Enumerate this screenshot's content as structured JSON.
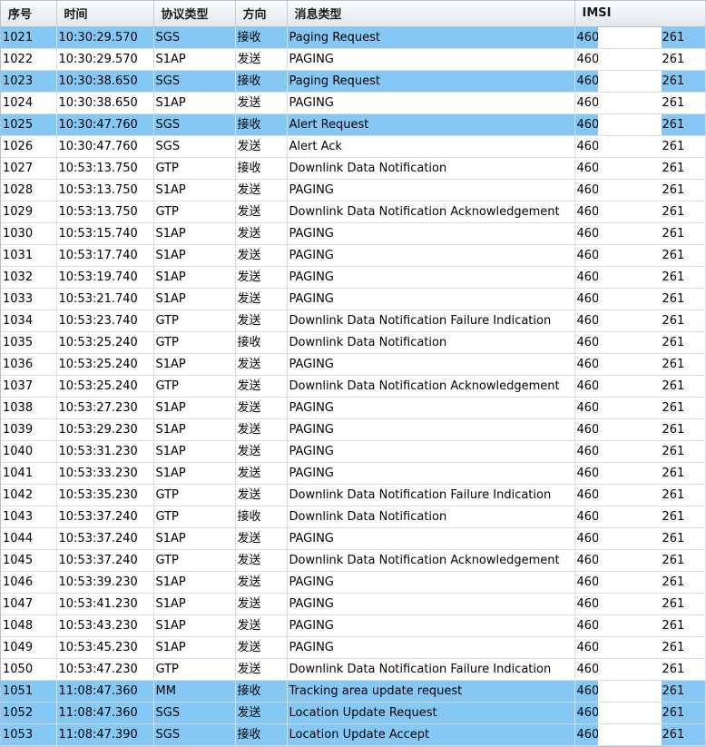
{
  "columns": [
    "序号",
    "时间",
    "协议类型",
    "方向",
    "消息类型",
    "IMSI"
  ],
  "colors": {
    "selected_row": "#86c8f5",
    "header_bg": "#e3e8ee",
    "grid_line": "#d8dde3"
  },
  "rows": [
    {
      "id": "1021",
      "time": "10:30:29.570",
      "proto": "SGS",
      "dir": "接收",
      "msg": "Paging Request",
      "imsi_prefix": "460",
      "imsi_suffix": "261",
      "selected": true
    },
    {
      "id": "1022",
      "time": "10:30:29.570",
      "proto": "S1AP",
      "dir": "发送",
      "msg": "PAGING",
      "imsi_prefix": "460",
      "imsi_suffix": "261",
      "selected": false
    },
    {
      "id": "1023",
      "time": "10:30:38.650",
      "proto": "SGS",
      "dir": "接收",
      "msg": "Paging Request",
      "imsi_prefix": "460",
      "imsi_suffix": "261",
      "selected": true
    },
    {
      "id": "1024",
      "time": "10:30:38.650",
      "proto": "S1AP",
      "dir": "发送",
      "msg": "PAGING",
      "imsi_prefix": "460",
      "imsi_suffix": "261",
      "selected": false
    },
    {
      "id": "1025",
      "time": "10:30:47.760",
      "proto": "SGS",
      "dir": "接收",
      "msg": "Alert Request",
      "imsi_prefix": "460",
      "imsi_suffix": "261",
      "selected": true
    },
    {
      "id": "1026",
      "time": "10:30:47.760",
      "proto": "SGS",
      "dir": "发送",
      "msg": "Alert Ack",
      "imsi_prefix": "460",
      "imsi_suffix": "261",
      "selected": false
    },
    {
      "id": "1027",
      "time": "10:53:13.750",
      "proto": "GTP",
      "dir": "接收",
      "msg": "Downlink Data Notification",
      "imsi_prefix": "460",
      "imsi_suffix": "261",
      "selected": false
    },
    {
      "id": "1028",
      "time": "10:53:13.750",
      "proto": "S1AP",
      "dir": "发送",
      "msg": "PAGING",
      "imsi_prefix": "460",
      "imsi_suffix": "261",
      "selected": false
    },
    {
      "id": "1029",
      "time": "10:53:13.750",
      "proto": "GTP",
      "dir": "发送",
      "msg": "Downlink Data Notification Acknowledgement",
      "imsi_prefix": "460",
      "imsi_suffix": "261",
      "selected": false
    },
    {
      "id": "1030",
      "time": "10:53:15.740",
      "proto": "S1AP",
      "dir": "发送",
      "msg": "PAGING",
      "imsi_prefix": "460",
      "imsi_suffix": "261",
      "selected": false
    },
    {
      "id": "1031",
      "time": "10:53:17.740",
      "proto": "S1AP",
      "dir": "发送",
      "msg": "PAGING",
      "imsi_prefix": "460",
      "imsi_suffix": "261",
      "selected": false
    },
    {
      "id": "1032",
      "time": "10:53:19.740",
      "proto": "S1AP",
      "dir": "发送",
      "msg": "PAGING",
      "imsi_prefix": "460",
      "imsi_suffix": "261",
      "selected": false
    },
    {
      "id": "1033",
      "time": "10:53:21.740",
      "proto": "S1AP",
      "dir": "发送",
      "msg": "PAGING",
      "imsi_prefix": "460",
      "imsi_suffix": "261",
      "selected": false
    },
    {
      "id": "1034",
      "time": "10:53:23.740",
      "proto": "GTP",
      "dir": "发送",
      "msg": "Downlink Data Notification Failure Indication",
      "imsi_prefix": "460",
      "imsi_suffix": "261",
      "selected": false
    },
    {
      "id": "1035",
      "time": "10:53:25.240",
      "proto": "GTP",
      "dir": "接收",
      "msg": "Downlink Data Notification",
      "imsi_prefix": "460",
      "imsi_suffix": "261",
      "selected": false
    },
    {
      "id": "1036",
      "time": "10:53:25.240",
      "proto": "S1AP",
      "dir": "发送",
      "msg": "PAGING",
      "imsi_prefix": "460",
      "imsi_suffix": "261",
      "selected": false
    },
    {
      "id": "1037",
      "time": "10:53:25.240",
      "proto": "GTP",
      "dir": "发送",
      "msg": "Downlink Data Notification Acknowledgement",
      "imsi_prefix": "460",
      "imsi_suffix": "261",
      "selected": false
    },
    {
      "id": "1038",
      "time": "10:53:27.230",
      "proto": "S1AP",
      "dir": "发送",
      "msg": "PAGING",
      "imsi_prefix": "460",
      "imsi_suffix": "261",
      "selected": false
    },
    {
      "id": "1039",
      "time": "10:53:29.230",
      "proto": "S1AP",
      "dir": "发送",
      "msg": "PAGING",
      "imsi_prefix": "460",
      "imsi_suffix": "261",
      "selected": false
    },
    {
      "id": "1040",
      "time": "10:53:31.230",
      "proto": "S1AP",
      "dir": "发送",
      "msg": "PAGING",
      "imsi_prefix": "460",
      "imsi_suffix": "261",
      "selected": false
    },
    {
      "id": "1041",
      "time": "10:53:33.230",
      "proto": "S1AP",
      "dir": "发送",
      "msg": "PAGING",
      "imsi_prefix": "460",
      "imsi_suffix": "261",
      "selected": false
    },
    {
      "id": "1042",
      "time": "10:53:35.230",
      "proto": "GTP",
      "dir": "发送",
      "msg": "Downlink Data Notification Failure Indication",
      "imsi_prefix": "460",
      "imsi_suffix": "261",
      "selected": false
    },
    {
      "id": "1043",
      "time": "10:53:37.240",
      "proto": "GTP",
      "dir": "接收",
      "msg": "Downlink Data Notification",
      "imsi_prefix": "460",
      "imsi_suffix": "261",
      "selected": false
    },
    {
      "id": "1044",
      "time": "10:53:37.240",
      "proto": "S1AP",
      "dir": "发送",
      "msg": "PAGING",
      "imsi_prefix": "460",
      "imsi_suffix": "261",
      "selected": false
    },
    {
      "id": "1045",
      "time": "10:53:37.240",
      "proto": "GTP",
      "dir": "发送",
      "msg": "Downlink Data Notification Acknowledgement",
      "imsi_prefix": "460",
      "imsi_suffix": "261",
      "selected": false
    },
    {
      "id": "1046",
      "time": "10:53:39.230",
      "proto": "S1AP",
      "dir": "发送",
      "msg": "PAGING",
      "imsi_prefix": "460",
      "imsi_suffix": "261",
      "selected": false
    },
    {
      "id": "1047",
      "time": "10:53:41.230",
      "proto": "S1AP",
      "dir": "发送",
      "msg": "PAGING",
      "imsi_prefix": "460",
      "imsi_suffix": "261",
      "selected": false
    },
    {
      "id": "1048",
      "time": "10:53:43.230",
      "proto": "S1AP",
      "dir": "发送",
      "msg": "PAGING",
      "imsi_prefix": "460",
      "imsi_suffix": "261",
      "selected": false
    },
    {
      "id": "1049",
      "time": "10:53:45.230",
      "proto": "S1AP",
      "dir": "发送",
      "msg": "PAGING",
      "imsi_prefix": "460",
      "imsi_suffix": "261",
      "selected": false
    },
    {
      "id": "1050",
      "time": "10:53:47.230",
      "proto": "GTP",
      "dir": "发送",
      "msg": "Downlink Data Notification Failure Indication",
      "imsi_prefix": "460",
      "imsi_suffix": "261",
      "selected": false
    },
    {
      "id": "1051",
      "time": "11:08:47.360",
      "proto": "MM",
      "dir": "接收",
      "msg": "Tracking area update request",
      "imsi_prefix": "460",
      "imsi_suffix": "261",
      "selected": true
    },
    {
      "id": "1052",
      "time": "11:08:47.360",
      "proto": "SGS",
      "dir": "发送",
      "msg": "Location Update Request",
      "imsi_prefix": "460",
      "imsi_suffix": "261",
      "selected": true
    },
    {
      "id": "1053",
      "time": "11:08:47.390",
      "proto": "SGS",
      "dir": "接收",
      "msg": "Location Update Accept",
      "imsi_prefix": "460",
      "imsi_suffix": "261",
      "selected": true
    }
  ]
}
